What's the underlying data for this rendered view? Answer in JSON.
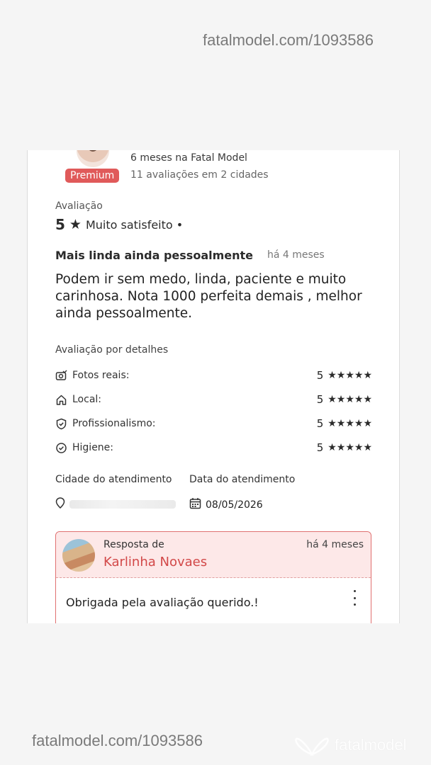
{
  "watermark": {
    "top_url": "fatalmodel.com/1093586",
    "bottom_url": "fatalmodel.com/1093586",
    "logo_text": "fatalmodel"
  },
  "profile": {
    "badge": "Premium",
    "time_on_site": "6 meses na Fatal Model",
    "reviews_summary": "11 avaliações em 2 cidades"
  },
  "review": {
    "rating_label": "Avaliação",
    "rating_value": "5",
    "rating_text": "Muito satisfeito •",
    "title": "Mais linda ainda pessoalmente",
    "time_ago": "há 4 meses",
    "body": "Podem ir sem medo, linda, paciente e muito carinhosa. Nota 1000 perfeita demais , melhor ainda pessoalmente."
  },
  "details": {
    "heading": "Avaliação por detalhes",
    "items": [
      {
        "label": "Fotos reais:",
        "value": "5",
        "stars": "★★★★★",
        "icon": "camera-check-icon"
      },
      {
        "label": "Local:",
        "value": "5",
        "stars": "★★★★★",
        "icon": "home-icon"
      },
      {
        "label": "Profissionalismo:",
        "value": "5",
        "stars": "★★★★★",
        "icon": "shield-check-icon"
      },
      {
        "label": "Higiene:",
        "value": "5",
        "stars": "★★★★★",
        "icon": "check-circle-icon"
      }
    ]
  },
  "service": {
    "city_label": "Cidade do atendimento",
    "date_label": "Data do atendimento",
    "date_value": "08/05/2026"
  },
  "reply": {
    "from_label": "Resposta de",
    "name": "Karlinha Novaes",
    "time_ago": "há 4 meses",
    "text": "Obrigada pela avaliação querido.!"
  },
  "colors": {
    "accent": "#d24848",
    "badge": "#e05a5a",
    "reply_bg": "#fde8e8"
  }
}
